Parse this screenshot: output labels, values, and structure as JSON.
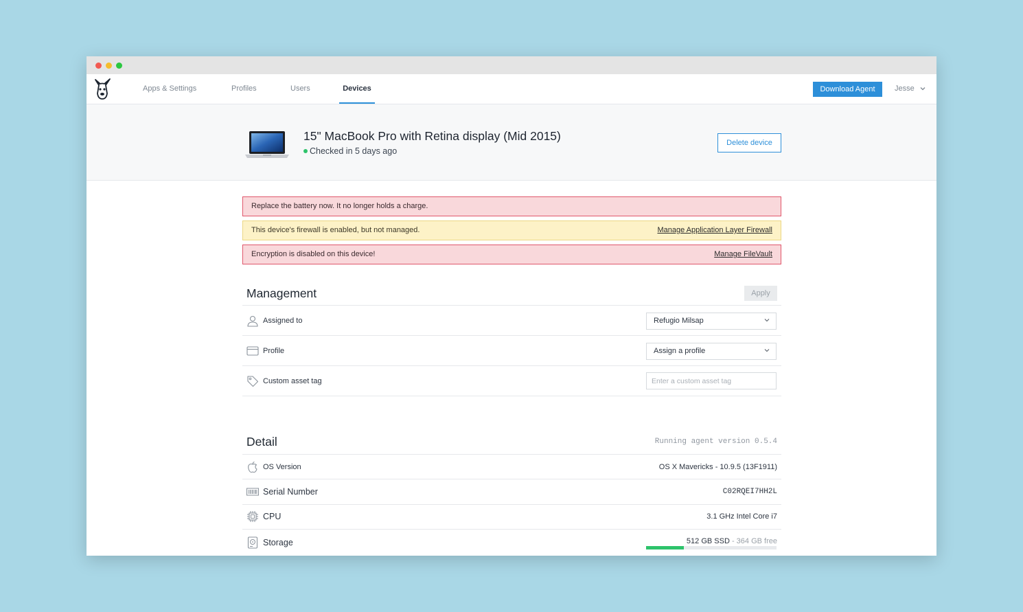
{
  "nav": {
    "items": [
      {
        "label": "Apps & Settings",
        "active": false
      },
      {
        "label": "Profiles",
        "active": false
      },
      {
        "label": "Users",
        "active": false
      },
      {
        "label": "Devices",
        "active": true
      }
    ],
    "download_label": "Download Agent",
    "user_label": "Jesse"
  },
  "device": {
    "title": "15\" MacBook Pro with Retina display (Mid 2015)",
    "status": "Checked in 5 days ago",
    "delete_label": "Delete device"
  },
  "alerts": [
    {
      "type": "danger",
      "message": "Replace the battery now. It no longer holds a charge.",
      "link": ""
    },
    {
      "type": "warning",
      "message": "This device's firewall is enabled, but not managed.",
      "link": "Manage Application Layer Firewall"
    },
    {
      "type": "danger",
      "message": "Encryption is disabled on this device!",
      "link": "Manage FileVault"
    }
  ],
  "management": {
    "title": "Management",
    "apply_label": "Apply",
    "assigned_to": {
      "label": "Assigned to",
      "value": "Refugio Milsap"
    },
    "profile": {
      "label": "Profile",
      "value": "Assign a profile"
    },
    "asset_tag": {
      "label": "Custom asset tag",
      "placeholder": "Enter a custom asset tag",
      "value": ""
    }
  },
  "detail": {
    "title": "Detail",
    "agent_version": "Running agent version 0.5.4",
    "os_version": {
      "label": "OS Version",
      "value": "OS X Mavericks - 10.9.5 (13F1911)"
    },
    "serial": {
      "label": "Serial Number",
      "value": "C02RQEI7HH2L"
    },
    "cpu": {
      "label": "CPU",
      "value": "3.1 GHz Intel Core i7"
    },
    "storage": {
      "label": "Storage",
      "value": "512 GB SSD",
      "free": "364 GB free",
      "separator": " - ",
      "used_fraction": 0.29
    }
  },
  "colors": {
    "accent": "#2d8fd9",
    "success": "#2ec36b",
    "danger_bg": "#f9d8db",
    "danger_border": "#e0566b",
    "warning_bg": "#fdf2c7",
    "warning_border": "#ecd784",
    "backdrop": "#a9d7e6"
  },
  "icons": {
    "logo": "dog-logo",
    "assigned_to": "user-icon",
    "profile": "card-icon",
    "asset_tag": "tag-icon",
    "os_version": "apple-icon",
    "serial": "barcode-icon",
    "cpu": "chip-icon",
    "storage": "disk-icon"
  }
}
